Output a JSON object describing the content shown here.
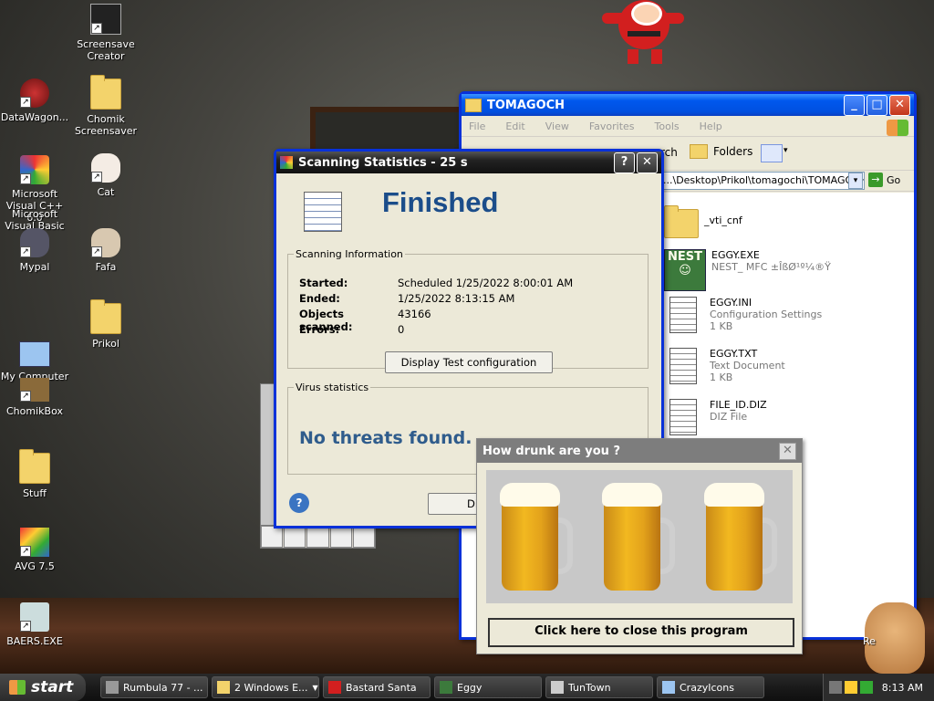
{
  "desktop_icons": [
    {
      "label": "Screensave Creator"
    },
    {
      "label": "DataWagon..."
    },
    {
      "label": "Chomik Screensaver"
    },
    {
      "label": "Microsoft Visual C++ 6.0"
    },
    {
      "label": "Microsoft Visual Basic 6.0"
    },
    {
      "label": "Cat"
    },
    {
      "label": "Mypal"
    },
    {
      "label": "Fafa"
    },
    {
      "label": "Prikol"
    },
    {
      "label": "My Computer"
    },
    {
      "label": "ChomikBox"
    },
    {
      "label": "Stuff"
    },
    {
      "label": "AVG 7.5"
    },
    {
      "label": "BAERS.EXE"
    }
  ],
  "explorer": {
    "title": "TOMAGOCH",
    "menu": [
      "File",
      "Edit",
      "View",
      "Favorites",
      "Tools",
      "Help"
    ],
    "toolbar": {
      "search_partial": "rch",
      "folders": "Folders"
    },
    "address": "...\\Desktop\\Prikol\\tomagochi\\TOMAGOCH",
    "go": "Go",
    "files": [
      {
        "name": "_vti_cnf",
        "type": "",
        "size": ""
      },
      {
        "name": "EGGY.EXE",
        "type": "NEST_ MFC ±ÎßØ¹º¼®Ÿ",
        "size": ""
      },
      {
        "name": "EGGY.INI",
        "type": "Configuration Settings",
        "size": "1 KB"
      },
      {
        "name": "EGGY.TXT",
        "type": "Text Document",
        "size": "1 KB"
      },
      {
        "name": "FILE_ID.DIZ",
        "type": "DIZ File",
        "size": ""
      }
    ],
    "nest_label": "NEST"
  },
  "scan": {
    "title": "Scanning Statistics - 25 s",
    "heading": "Finished",
    "info_group": "Scanning Information",
    "rows": [
      {
        "key": "Started:",
        "value": "Scheduled 1/25/2022 8:00:01 AM"
      },
      {
        "key": "Ended:",
        "value": "1/25/2022 8:13:15 AM"
      },
      {
        "key": "Objects scanned:",
        "value": "43166"
      },
      {
        "key": "Errors:",
        "value": "0"
      }
    ],
    "display_config_btn": "Display Test configuration",
    "virus_group": "Virus statistics",
    "result": "No threats found.",
    "partial_btn": "Dis"
  },
  "drunk": {
    "title": "How drunk are you ?",
    "close_btn": "Click here to close this program"
  },
  "hamster_label": "Re",
  "taskbar": {
    "start": "start",
    "tasks": [
      "Rumbula 77 - ...",
      "2 Windows E...",
      "Bastard Santa",
      "Eggy",
      "TunTown",
      "CrazyIcons"
    ],
    "clock": "8:13 AM"
  },
  "colors": {
    "finished_blue": "#1b4d8a",
    "xp_blue": "#0058ee"
  }
}
